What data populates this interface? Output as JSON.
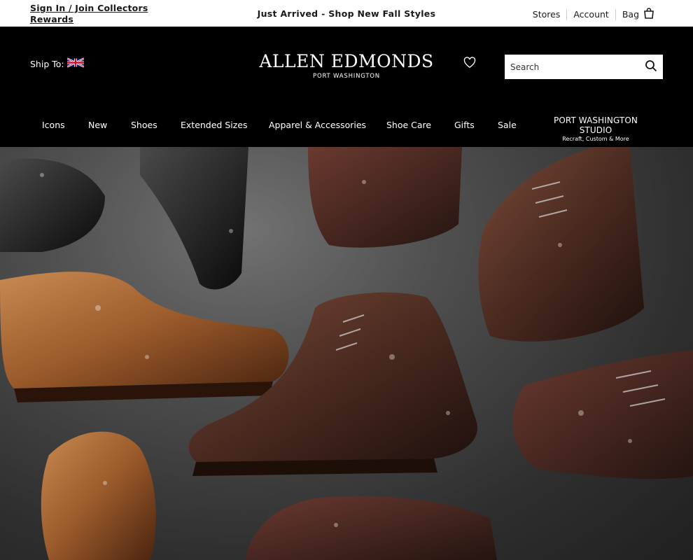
{
  "topbar": {
    "signin_label": "Sign In / Join Collectors Rewards",
    "promo_text": "Just Arrived - Shop New Fall Styles",
    "stores_label": "Stores",
    "account_label": "Account",
    "bag_label": "Bag"
  },
  "header": {
    "ship_to_label": "Ship To:",
    "logo_title": "ALLEN EDMONDS",
    "logo_subtitle": "PORT WASHINGTON"
  },
  "search": {
    "placeholder": "Search"
  },
  "nav": {
    "items": [
      {
        "label": "Icons"
      },
      {
        "label": "New"
      },
      {
        "label": "Shoes"
      },
      {
        "label": "Extended Sizes"
      },
      {
        "label": "Apparel & Accessories"
      },
      {
        "label": "Shoe Care"
      },
      {
        "label": "Gifts"
      },
      {
        "label": "Sale"
      }
    ],
    "studio_title": "PORT WASHINGTON STUDIO",
    "studio_subtitle": "Recraft, Custom & More"
  },
  "icons": {
    "flag": "uk-flag-icon",
    "wishlist": "heart-icon",
    "search": "search-icon",
    "bag": "shopping-bag-icon"
  },
  "colors": {
    "header_bg": "#000000",
    "topbar_bg": "#ffffff",
    "text_dark": "#1a1a1a"
  }
}
